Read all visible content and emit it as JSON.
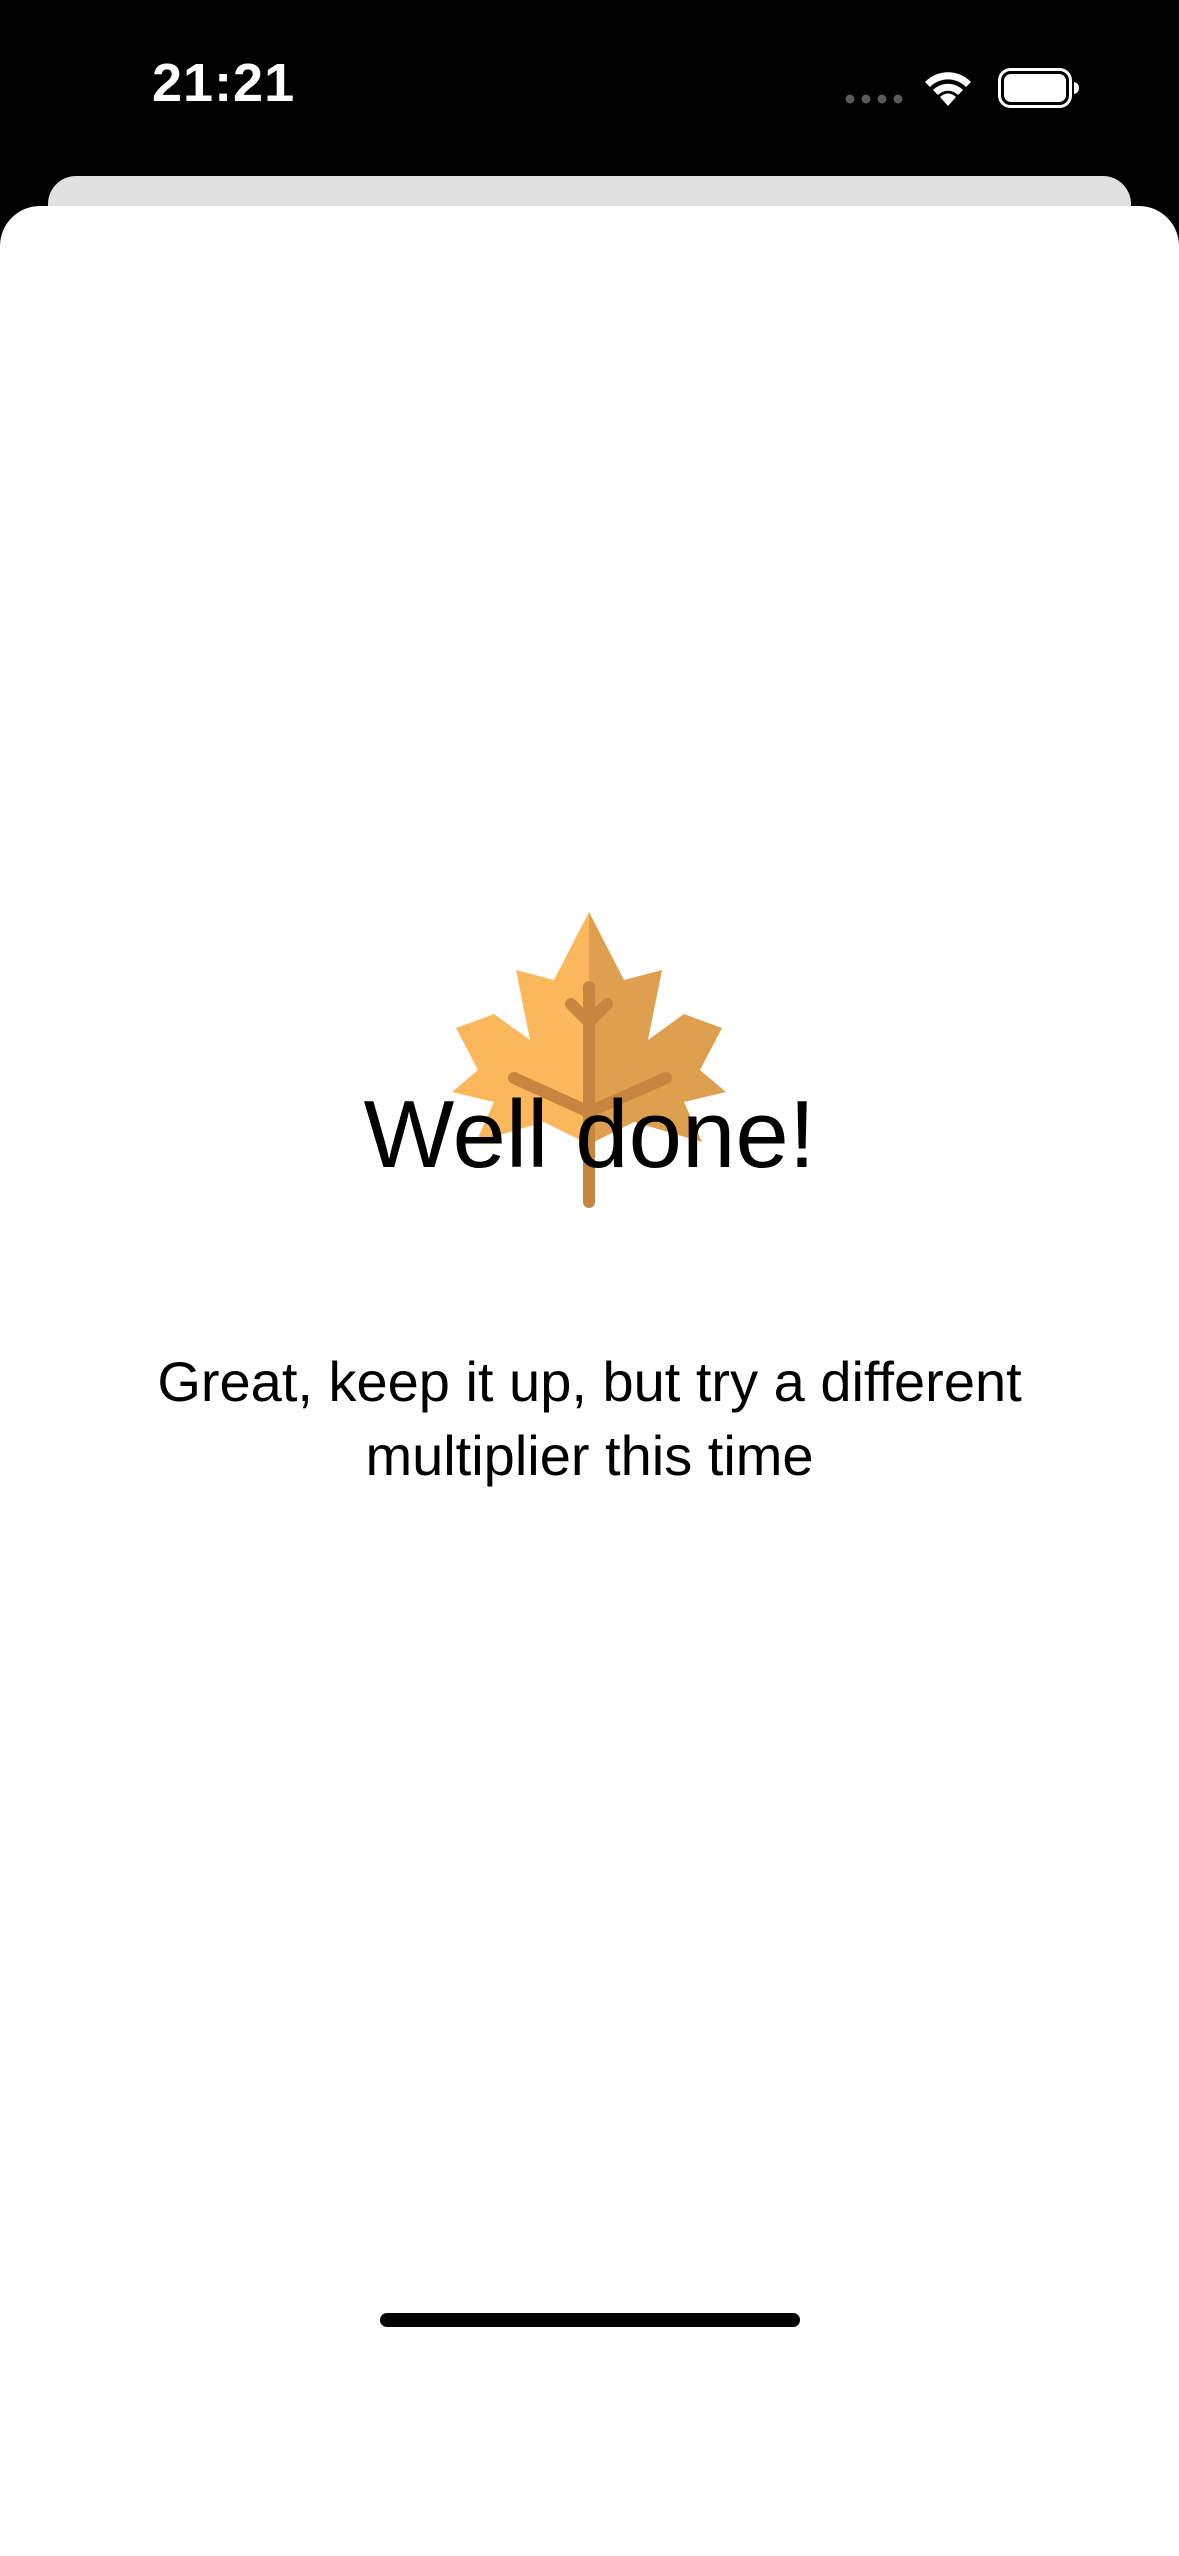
{
  "status_bar": {
    "time": "21:21",
    "signal_icon": "cellular-signal-dots",
    "wifi_icon": "wifi-icon",
    "battery_icon": "battery-full-icon"
  },
  "sheet": {
    "icon": "maple-leaf-icon",
    "title": "Well done!",
    "message": "Great, keep it up, but try a different multiplier this time"
  },
  "colors": {
    "leaf_light": "#FBB75C",
    "leaf_dark": "#DE9F4E",
    "leaf_vein": "#C7863F",
    "background": "#FFFFFF",
    "status_bar": "#000000",
    "sheet_back": "#E1E1E1"
  }
}
